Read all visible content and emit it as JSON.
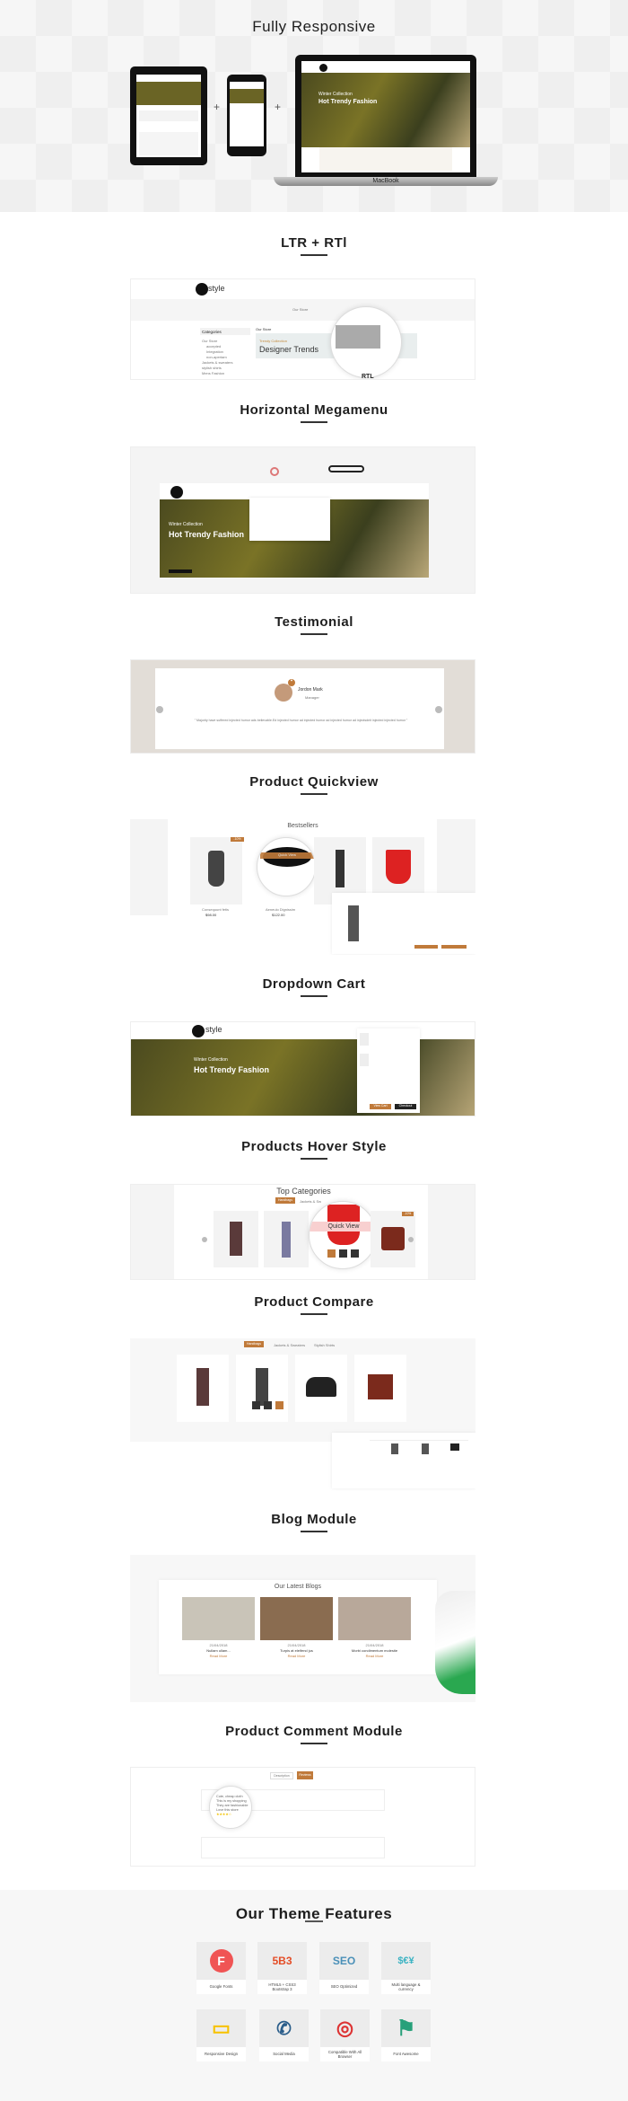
{
  "sections": {
    "responsive": {
      "title": "Fully Responsive",
      "plus": "+",
      "hero_sub": "Winter Collection",
      "hero_title": "Hot Trendy Fashion",
      "laptop_brand": "MacBook"
    },
    "ltr": {
      "title": "LTR + RTl",
      "breadcrumb": "Our Store",
      "categories": "Categories",
      "cat_items": [
        "Our Store",
        "accepted",
        "Integration",
        "non-apertam",
        "Jackets & sweaters",
        "stylish shirts",
        "Mens Fashion"
      ],
      "heading": "Our Store",
      "banner_sub": "Trendy Collection",
      "banner_title": "Designer Trends",
      "rtl": "RTL"
    },
    "megamenu": {
      "title": "Horizontal Megamenu",
      "hero_sub": "Winter Collection",
      "hero_title": "Hot Trendy Fashion"
    },
    "testimonial": {
      "title": "Testimonial",
      "name": "Jordon Mark",
      "role": "Manager",
      "quote": "\" Majority have suffered injected humor ads believable.Ed injected humor ad injected humor ad injected humor ad injectsdeit injected injected humor \""
    },
    "quickview": {
      "title": "Product Quickview",
      "block_title": "Bestsellers",
      "quick_view": "Quick View",
      "products": [
        {
          "name": "Consequunt fetis",
          "price": "$98.00"
        },
        {
          "name": "Aeneulo Dignissim",
          "price": "$122.00"
        },
        {
          "name": "",
          "price": ""
        },
        {
          "name": "",
          "price": ""
        }
      ],
      "sale": "-10%"
    },
    "cart": {
      "title": "Dropdown Cart",
      "hero_sub": "Winter Collection",
      "hero_title": "Hot Trendy Fashion",
      "view_cart": "View Cart",
      "checkout": "Checkout"
    },
    "hover": {
      "title": "Products Hover Style",
      "block_title": "Top Categories",
      "tab_active": "Handbags",
      "tab2": "Jackets & Sw",
      "quick_view": "Quick View",
      "sale": "-10%"
    },
    "compare": {
      "title": "Product Compare",
      "tab_active": "Handbags",
      "tab2": "Jackets & Sweaters",
      "tab3": "Stylish Shirts"
    },
    "blog": {
      "title": "Blog Module",
      "block_title": "Our Latest Blogs",
      "posts": [
        {
          "date": "21/04/2018",
          "title": "Nullam ullam...",
          "read": "Read More"
        },
        {
          "date": "21/04/2018",
          "title": "Turpis at eleifend jus",
          "read": "Read More"
        },
        {
          "date": "21/04/2018",
          "title": "Morbi condimentum molestie",
          "read": "Read More"
        }
      ]
    },
    "comment": {
      "title": "Product Comment Module",
      "tab1": "Description",
      "tab2": "Reviews (1)",
      "lines": [
        "Cute, cheap cloth",
        "This is my shopping",
        "They are fashionable",
        "Love this store"
      ],
      "stars": "★★★★☆"
    }
  },
  "features": {
    "title": "Our Theme Features",
    "items": [
      {
        "label": "Google Fonts",
        "icon": "google-fonts-icon",
        "glyph": "F",
        "color": "#f05454"
      },
      {
        "label": "HTML5 + CSS3 Bootstrap 3",
        "icon": "html5-css3-bootstrap-icon",
        "glyph": "5B3",
        "color": "#e44d26"
      },
      {
        "label": "SEO Optimized",
        "icon": "seo-icon",
        "glyph": "SEO",
        "color": "#4a90b8"
      },
      {
        "label": "Multi language & currency",
        "icon": "world-currency-icon",
        "glyph": "$€¥",
        "color": "#3bb3c3"
      },
      {
        "label": "Responsive Design",
        "icon": "responsive-devices-icon",
        "glyph": "▭",
        "color": "#f7c200"
      },
      {
        "label": "Social Media",
        "icon": "social-media-icon",
        "glyph": "✆",
        "color": "#2a5d8a"
      },
      {
        "label": "Compatible With All Browser",
        "icon": "browsers-icon",
        "glyph": "◎",
        "color": "#d33"
      },
      {
        "label": "Font Awesome",
        "icon": "flag-icon",
        "glyph": "⚑",
        "color": "#27a07a"
      }
    ]
  }
}
